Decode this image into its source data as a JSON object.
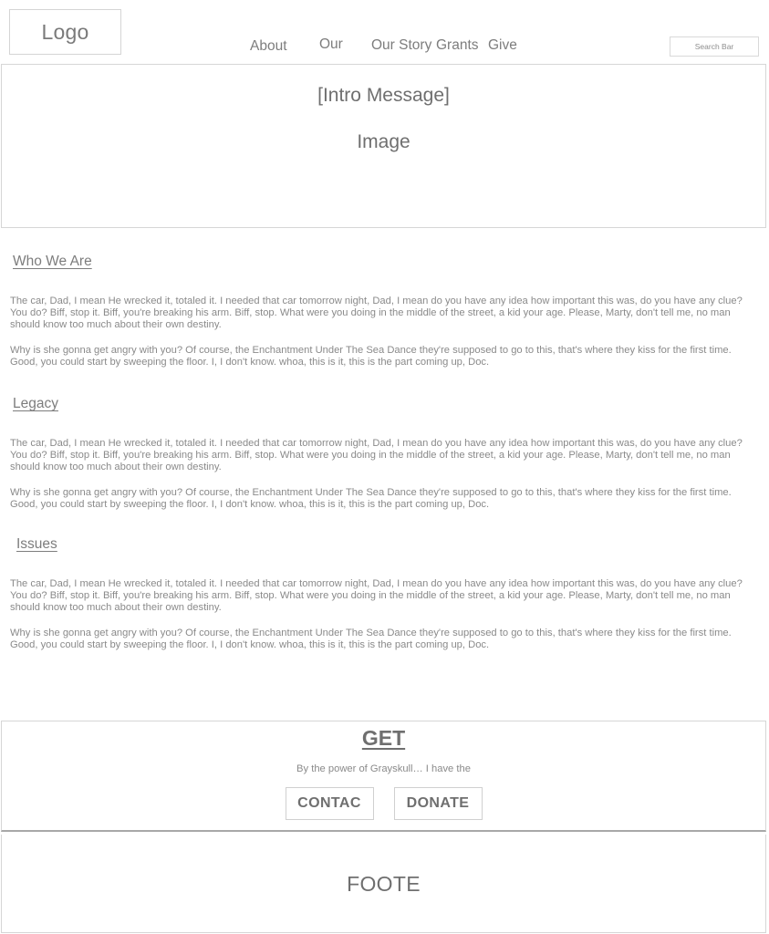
{
  "header": {
    "logo_label": "Logo",
    "nav_items": [
      {
        "label": "About"
      },
      {
        "label": "Our"
      },
      {
        "label": "Our Story"
      },
      {
        "label": "Grants"
      },
      {
        "label": "Give"
      }
    ],
    "search": {
      "label": "Search Bar",
      "placeholder": "Search Bar"
    }
  },
  "hero": {
    "intro_label": "[Intro Message]",
    "image_label": "Image"
  },
  "sections": [
    {
      "heading": "Who We Are",
      "paragraphs": [
        "The car, Dad, I mean He wrecked it, totaled it. I needed that car tomorrow night, Dad, I mean do you have any idea how important this was, do you have any clue? You do? Biff, stop it. Biff, you're breaking his arm. Biff, stop. What were you doing in the middle of the street, a kid your age. Please, Marty, don't tell me, no man should know too much about their own destiny.",
        "Why is she gonna get angry with you? Of course, the Enchantment Under The Sea Dance they're supposed to go to this, that's where they kiss for the first time. Good, you could start by sweeping the floor. I, I don't know. whoa, this is it, this is the part coming up, Doc."
      ]
    },
    {
      "heading": "Legacy",
      "paragraphs": [
        "The car, Dad, I mean He wrecked it, totaled it. I needed that car tomorrow night, Dad, I mean do you have any idea how important this was, do you have any clue? You do? Biff, stop it. Biff, you're breaking his arm. Biff, stop. What were you doing in the middle of the street, a kid your age. Please, Marty, don't tell me, no man should know too much about their own destiny.",
        "Why is she gonna get angry with you? Of course, the Enchantment Under The Sea Dance they're supposed to go to this, that's where they kiss for the first time. Good, you could start by sweeping the floor. I, I don't know. whoa, this is it, this is the part coming up, Doc."
      ]
    },
    {
      "heading": "Issues",
      "paragraphs": [
        "The car, Dad, I mean He wrecked it, totaled it. I needed that car tomorrow night, Dad, I mean do you have any idea how important this was, do you have any clue? You do? Biff, stop it. Biff, you're breaking his arm. Biff, stop. What were you doing in the middle of the street, a kid your age. Please, Marty, don't tell me, no man should know too much about their own destiny.",
        "Why is she gonna get angry with you? Of course, the Enchantment Under The Sea Dance they're supposed to go to this, that's where they kiss for the first time. Good, you could start by sweeping the floor. I, I don't know. whoa, this is it, this is the part coming up, Doc."
      ]
    }
  ],
  "cta": {
    "title": "GET",
    "subtitle": "By the power of Grayskull… I have the",
    "contact_button": "CONTAC",
    "donate_button": "DONATE"
  },
  "footer": {
    "label": "FOOTE"
  },
  "colors": {
    "text": "#808080",
    "border": "#d6d6d6",
    "heading": "#6f6f6f",
    "body": "#8a8a8a",
    "background": "#ffffff"
  }
}
